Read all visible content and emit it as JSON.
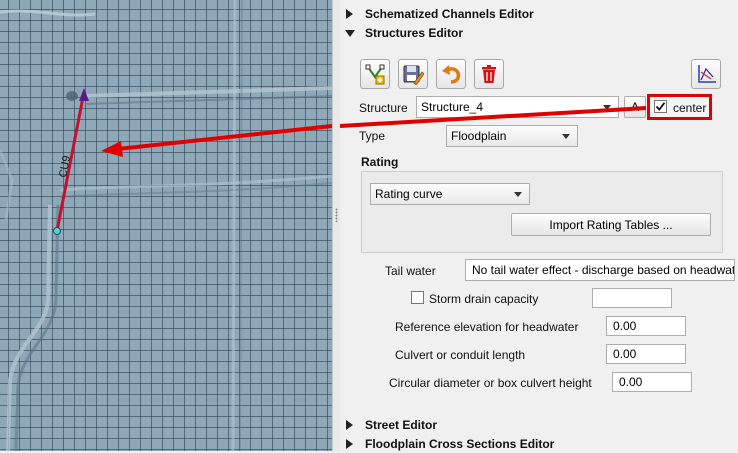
{
  "sections": {
    "schematized_channels": "Schematized Channels Editor",
    "structures": "Structures Editor",
    "street": "Street Editor",
    "floodplain_xs": "Floodplain Cross Sections Editor"
  },
  "toolbar": {
    "buttons": [
      "add-structure",
      "save-structure",
      "revert",
      "delete-structure"
    ],
    "icons": [
      "vertex-add-icon",
      "save-edit-icon",
      "undo-arrow-icon",
      "trash-icon",
      "axis-plot-icon"
    ]
  },
  "structure": {
    "label": "Structure",
    "selected": "Structure_4",
    "abbrev_button": "A",
    "center_label": "center",
    "center_checked": true
  },
  "type": {
    "label": "Type",
    "selected": "Floodplain"
  },
  "rating": {
    "title": "Rating",
    "selected": "Rating curve",
    "import_button": "Import Rating Tables ..."
  },
  "tail_water": {
    "label": "Tail water",
    "value": "No tail water effect - discharge based on headwater"
  },
  "storm_drain": {
    "label": "Storm drain capacity",
    "checked": false,
    "value": ""
  },
  "reference_elevation": {
    "label": "Reference elevation for headwater",
    "value": "0.00"
  },
  "culvert_length": {
    "label": "Culvert or conduit length",
    "value": "0.00"
  },
  "culvert_diameter": {
    "label": "Circular diameter or box culvert height",
    "value": "0.00"
  },
  "map": {
    "structure_label": "CU9"
  },
  "colors": {
    "annotation_red": "#e00000",
    "map_bg": "#8ea8b8",
    "structure_line": "#c8102e"
  }
}
